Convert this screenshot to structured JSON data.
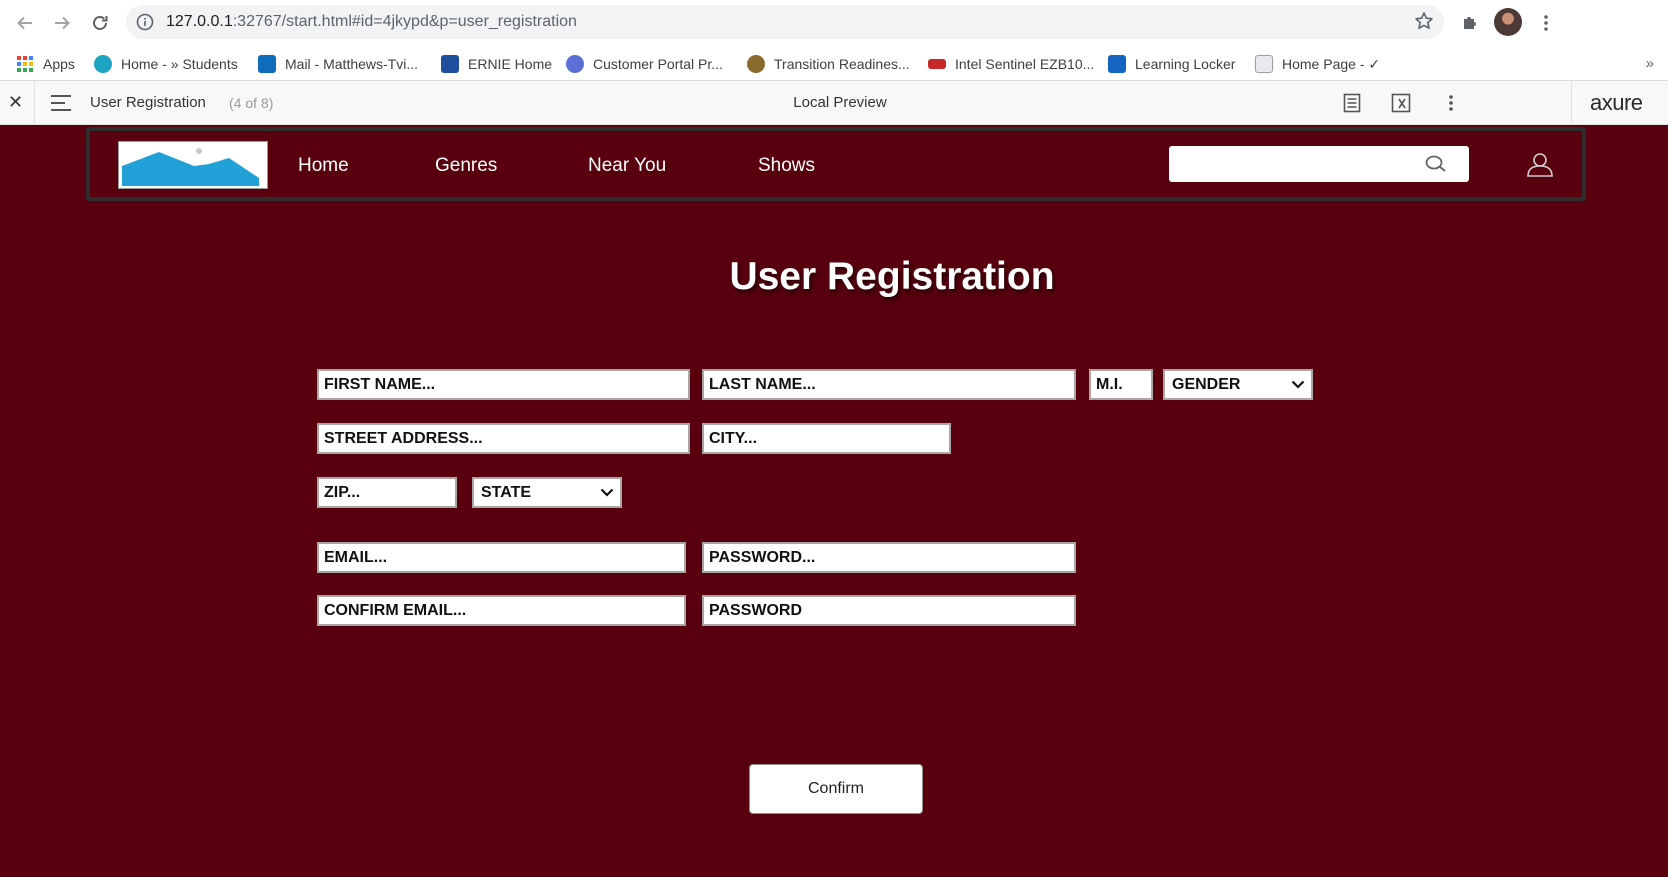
{
  "browser": {
    "url_host": "127.0.0.1",
    "url_rest": ":32767/start.html#id=4jkypd&p=user_registration",
    "bookmarks": [
      {
        "label": "Apps",
        "icon": "apps-grid-icon",
        "color": "#4285f4"
      },
      {
        "label": "Home - » Students",
        "icon": "students-icon",
        "color": "#1fa3c2"
      },
      {
        "label": "Mail - Matthews-Tvi...",
        "icon": "outlook-icon",
        "color": "#0f6cbd"
      },
      {
        "label": "ERNIE Home",
        "icon": "ernie-icon",
        "color": "#1f4e9c"
      },
      {
        "label": "Customer Portal Pr...",
        "icon": "portal-icon",
        "color": "#5b6fd6"
      },
      {
        "label": "Transition Readines...",
        "icon": "eagle-globe-anchor-icon",
        "color": "#8b6b2e"
      },
      {
        "label": "Intel Sentinel EZB10...",
        "icon": "sentinel-icon",
        "color": "#c62828"
      },
      {
        "label": "Learning Locker",
        "icon": "mdb-icon",
        "color": "#1565c0"
      },
      {
        "label": "Home Page - ✓",
        "icon": "page-icon",
        "color": "#9aa0a6"
      }
    ]
  },
  "axure": {
    "page_title": "User Registration",
    "page_count": "(4 of 8)",
    "center_label": "Local Preview",
    "logo": "axure"
  },
  "site": {
    "nav": [
      "Home",
      "Genres",
      "Near You",
      "Shows"
    ],
    "search_value": ""
  },
  "form": {
    "title": "User Registration",
    "first_name": "FIRST NAME...",
    "last_name": "LAST NAME...",
    "mi": "M.I.",
    "gender": "GENDER",
    "street": "STREET ADDRESS...",
    "city": "CITY...",
    "zip": "ZIP...",
    "state": "STATE",
    "email": "EMAIL...",
    "password": "PASSWORD...",
    "confirm_email": "CONFIRM EMAIL...",
    "confirm_password": "PASSWORD",
    "confirm_button": "Confirm"
  },
  "colors": {
    "page_background": "#58000e",
    "header_border": "#2e2e2e",
    "logo_mountain": "#22a0d8"
  }
}
